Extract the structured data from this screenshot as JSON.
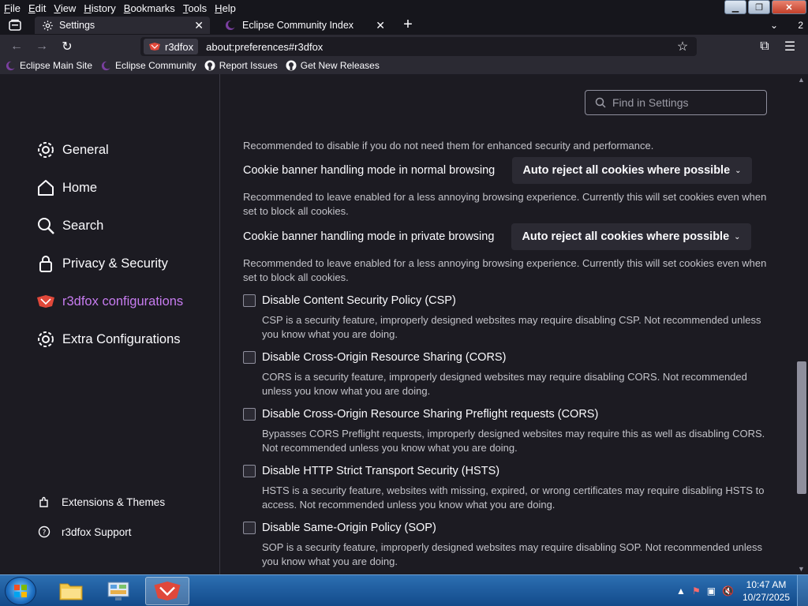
{
  "menu": {
    "items": [
      "File",
      "Edit",
      "View",
      "History",
      "Bookmarks",
      "Tools",
      "Help"
    ]
  },
  "window_controls": {
    "minimize": "▁",
    "restore": "❐",
    "close": "✕"
  },
  "tabs": [
    {
      "label": "Settings",
      "icon": "gear-icon"
    },
    {
      "label": "Eclipse Community Index",
      "icon": "eclipse-icon"
    }
  ],
  "tab_count": "2",
  "tab_close_glyph": "✕",
  "new_tab_glyph": "+",
  "nav": {
    "identity_label": "r3dfox",
    "url": "about:preferences#r3dfox"
  },
  "bookmarks": [
    {
      "label": "Eclipse Main Site",
      "icon": "eclipse-icon"
    },
    {
      "label": "Eclipse Community",
      "icon": "eclipse-icon"
    },
    {
      "label": "Report Issues",
      "icon": "github-icon"
    },
    {
      "label": "Get New Releases",
      "icon": "github-icon"
    }
  ],
  "sidebar": {
    "categories": [
      {
        "label": "General",
        "icon": "gear-icon"
      },
      {
        "label": "Home",
        "icon": "home-icon"
      },
      {
        "label": "Search",
        "icon": "search-icon"
      },
      {
        "label": "Privacy & Security",
        "icon": "lock-icon"
      },
      {
        "label": "r3dfox configurations",
        "icon": "r3dfox-icon",
        "selected": true
      },
      {
        "label": "Extra Configurations",
        "icon": "gear-icon"
      }
    ],
    "footer": [
      {
        "label": "Extensions & Themes",
        "icon": "puzzle-icon"
      },
      {
        "label": "r3dfox Support",
        "icon": "help-icon"
      }
    ]
  },
  "search": {
    "placeholder": "Find in Settings"
  },
  "main": {
    "intro_desc": "Recommended to disable if you do not need them for enhanced security and performance.",
    "cookie_rows": [
      {
        "label": "Cookie banner handling mode in normal browsing",
        "value": "Auto reject all cookies where possible",
        "desc": "Recommended to leave enabled for a less annoying browsing experience. Currently this will set cookies even when set to block all cookies."
      },
      {
        "label": "Cookie banner handling mode in private browsing",
        "value": "Auto reject all cookies where possible",
        "desc": "Recommended to leave enabled for a less annoying browsing experience. Currently this will set cookies even when set to block all cookies."
      }
    ],
    "checkboxes": [
      {
        "label": "Disable Content Security Policy (CSP)",
        "checked": false,
        "desc": "CSP is a security feature, improperly designed websites may require disabling CSP. Not recommended unless you know what you are doing."
      },
      {
        "label": "Disable Cross-Origin Resource Sharing (CORS)",
        "checked": false,
        "desc": "CORS is a security feature, improperly designed websites may require disabling CORS. Not recommended unless you know what you are doing."
      },
      {
        "label": "Disable Cross-Origin Resource Sharing Preflight requests (CORS)",
        "checked": false,
        "desc": "Bypasses CORS Preflight requests, improperly designed websites may require this as well as disabling CORS. Not recommended unless you know what you are doing."
      },
      {
        "label": "Disable HTTP Strict Transport Security (HSTS)",
        "checked": false,
        "desc": "HSTS is a security feature, websites with missing, expired, or wrong certificates may require disabling HSTS to access. Not recommended unless you know what you are doing."
      },
      {
        "label": "Disable Same-Origin Policy (SOP)",
        "checked": false,
        "desc": "SOP is a security feature, improperly designed websites may require disabling SOP. Not recommended unless you know what you are doing."
      }
    ]
  },
  "taskbar": {
    "time": "10:47 AM",
    "date": "10/27/2025"
  },
  "colors": {
    "accent": "#c77cf0",
    "background": "#1c1b22",
    "toolbar": "#2b2a33",
    "taskbar": "#1d5ea3"
  }
}
